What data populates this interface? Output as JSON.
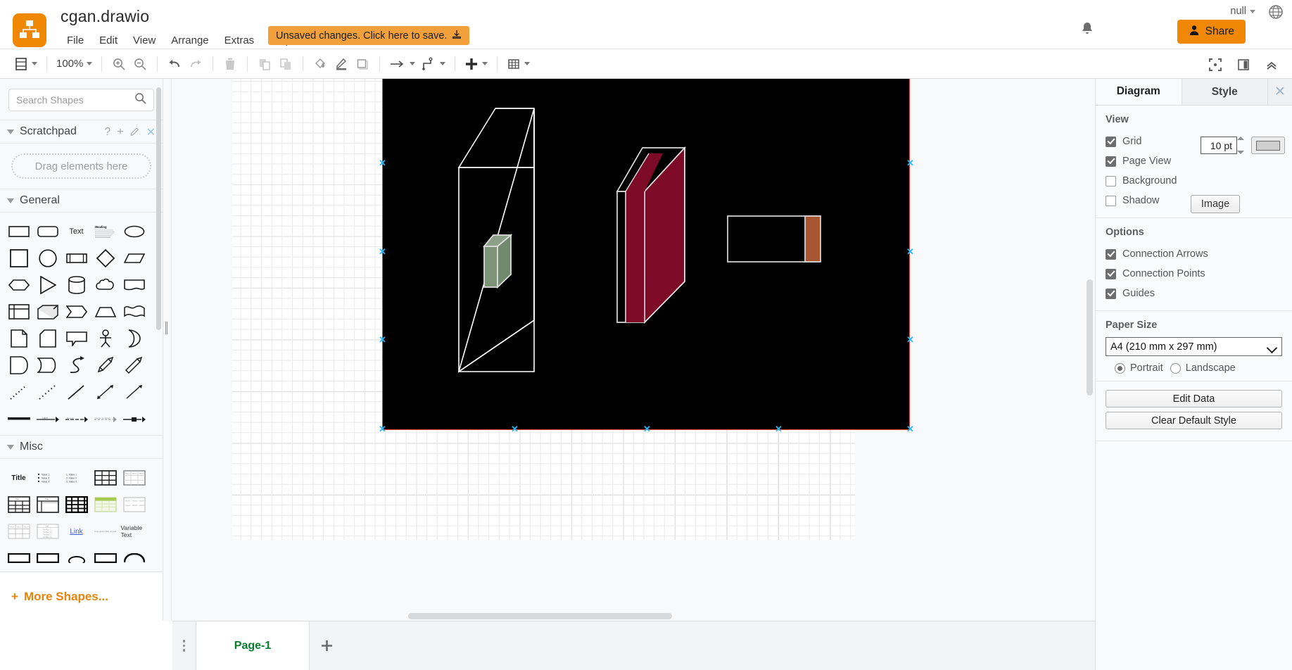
{
  "app": {
    "filename": "cgan.drawio",
    "logo_icon": "drawio-logo-icon",
    "unsaved_message": "Unsaved changes. Click here to save.",
    "language_label": "null",
    "share_label": "Share"
  },
  "menubar": {
    "items": [
      "File",
      "Edit",
      "View",
      "Arrange",
      "Extras",
      "Help"
    ]
  },
  "toolbar": {
    "view_icon": "view-layout-icon",
    "zoom_level": "100%",
    "zoom_in_icon": "zoom-in-icon",
    "zoom_out_icon": "zoom-out-icon",
    "undo_icon": "undo-icon",
    "redo_icon": "redo-icon",
    "delete_icon": "trash-icon",
    "to_front_icon": "bring-to-front-icon",
    "to_back_icon": "send-to-back-icon",
    "fill_icon": "fill-color-icon",
    "line_icon": "line-color-icon",
    "shadow_icon": "shadow-icon",
    "connection_icon": "connection-arrow-icon",
    "waypoints_icon": "waypoints-icon",
    "insert_icon": "plus-insert-icon",
    "table_icon": "table-insert-icon",
    "fullscreen_icon": "fullscreen-icon",
    "format_panel_icon": "format-panel-icon",
    "collapse_icon": "collapse-toolbar-icon"
  },
  "shapes_panel": {
    "search_placeholder": "Search Shapes",
    "search_value": "",
    "search_icon": "search-icon",
    "scratchpad": {
      "title": "Scratchpad",
      "drop_hint": "Drag elements here",
      "help_icon": "help-icon",
      "add_icon": "plus-icon",
      "edit_icon": "pencil-icon",
      "close_icon": "close-icon"
    },
    "general": {
      "title": "General",
      "shapes": [
        "rectangle",
        "rounded-rectangle",
        "text",
        "textbox-heading",
        "ellipse",
        "square",
        "circle",
        "process",
        "diamond",
        "parallelogram",
        "hexagon",
        "triangle",
        "cylinder",
        "cloud",
        "document",
        "internal-storage",
        "cube",
        "step",
        "trapezoid",
        "tape",
        "note",
        "card",
        "callout",
        "actor",
        "or",
        "data-storage",
        "curve-shape",
        "s-curve-arrow",
        "bidirectional-arrow",
        "arrow",
        "dotted-line",
        "dashed-line",
        "line",
        "bidirectional-connector",
        "directional-connector",
        "thick-line",
        "link-edge",
        "dashed-link-edge",
        "dotted-link-edge",
        "edge-with-label"
      ]
    },
    "misc": {
      "title": "Misc",
      "shapes": [
        "title-text",
        "unordered-list",
        "ordered-list",
        "table-grid",
        "table-with-header",
        "table-titled",
        "table-sidebar",
        "table-bold",
        "table-green",
        "table-plain",
        "table-cells",
        "list-panel",
        "link",
        "paragraph-text",
        "variable-text",
        "shape-row-4a",
        "shape-row-4b",
        "shape-row-4c",
        "shape-row-4d",
        "shape-row-4e"
      ]
    },
    "more_shapes_label": "More Shapes..."
  },
  "format_panel": {
    "tabs": [
      {
        "label": "Diagram",
        "active": true
      },
      {
        "label": "Style",
        "active": false
      }
    ],
    "close_icon": "close-icon",
    "view": {
      "title": "View",
      "grid": {
        "label": "Grid",
        "checked": true,
        "size_value": "10 pt",
        "color_swatch": "#cfcfcf"
      },
      "page_view": {
        "label": "Page View",
        "checked": true
      },
      "background": {
        "label": "Background",
        "checked": false,
        "button_label": "Image"
      },
      "shadow": {
        "label": "Shadow",
        "checked": false
      }
    },
    "options": {
      "title": "Options",
      "items": [
        {
          "label": "Connection Arrows",
          "checked": true
        },
        {
          "label": "Connection Points",
          "checked": true
        },
        {
          "label": "Guides",
          "checked": true
        }
      ]
    },
    "paper": {
      "title": "Paper Size",
      "selected": "A4 (210 mm x 297 mm)",
      "orientation": [
        {
          "label": "Portrait",
          "selected": true
        },
        {
          "label": "Landscape",
          "selected": false
        }
      ]
    },
    "actions": {
      "edit_data": "Edit Data",
      "clear_default_style": "Clear Default Style"
    }
  },
  "canvas": {
    "page_background": "#000000",
    "page_border": "#e8413c",
    "selection_handle_color": "#29b6f6",
    "shapes": [
      {
        "name": "large-outline-cube",
        "fill": "none",
        "stroke": "#ffffff"
      },
      {
        "name": "small-green-cube",
        "fill": "#7d9479",
        "stroke": "#d9d9d9"
      },
      {
        "name": "dark-red-cube",
        "fill": "#7d0a26",
        "stroke": "#d9d9d9"
      },
      {
        "name": "flat-rectangle",
        "fill": "none",
        "stroke": "#d9d9d9"
      },
      {
        "name": "orange-bar",
        "fill": "#a85532",
        "stroke": "#d9d9d9"
      }
    ]
  },
  "bottom_bar": {
    "menu_icon": "page-menu-icon",
    "pages": [
      {
        "label": "Page-1",
        "active": true
      }
    ],
    "add_page_icon": "plus-icon"
  }
}
